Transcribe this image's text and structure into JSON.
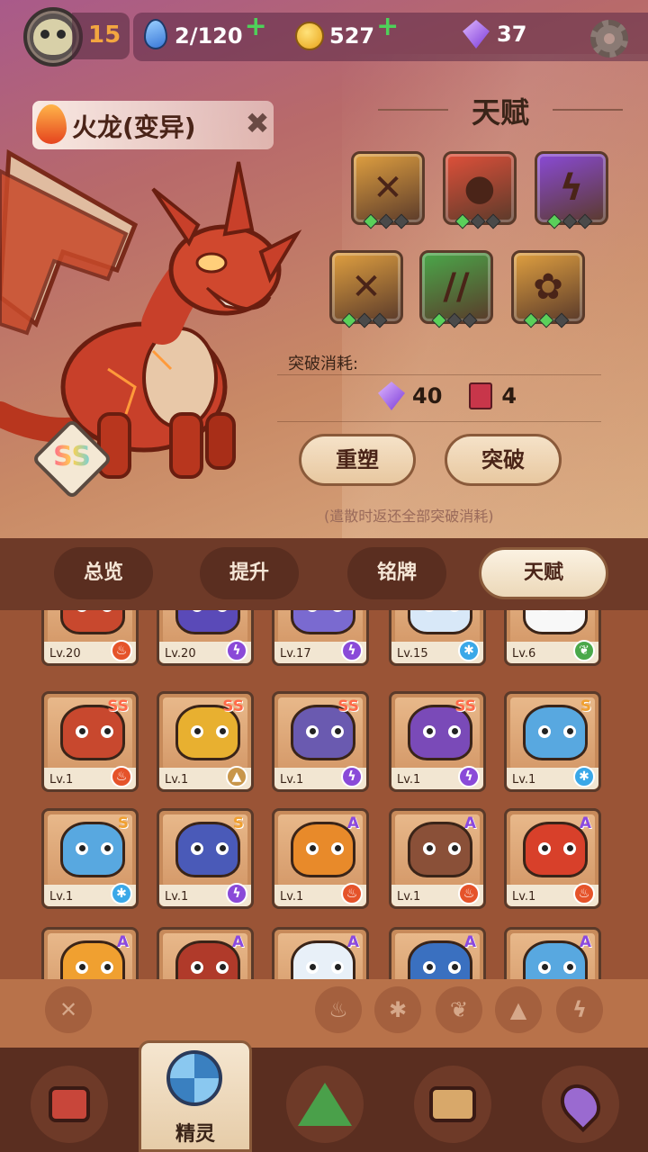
{
  "status": {
    "player_level": "15",
    "stamina": "2/120",
    "coins": "527",
    "gems": "37",
    "icons": [
      "avatar",
      "water-drop-icon",
      "coin-icon",
      "gem-icon",
      "gear-icon"
    ]
  },
  "pet": {
    "name": "火龙(变异)",
    "rank": "SS",
    "element": "fire"
  },
  "talent_panel": {
    "title": "天赋",
    "talents": [
      {
        "icon": "claw-slash-icon",
        "color": "#e0a040",
        "level": 1,
        "max": 3
      },
      {
        "icon": "fire-burst-icon",
        "color": "#e0503a",
        "level": 1,
        "max": 3
      },
      {
        "icon": "lightning-icon",
        "color": "#8a4ad8",
        "level": 1,
        "max": 3
      },
      {
        "icon": "claw-slash-icon",
        "color": "#e0a040",
        "level": 1,
        "max": 3
      },
      {
        "icon": "grass-slash-icon",
        "color": "#4aa84a",
        "level": 1,
        "max": 3
      },
      {
        "icon": "paw-icon",
        "color": "#e0a040",
        "level": 2,
        "max": 3
      }
    ],
    "breakthrough_label": "突破消耗:",
    "cost_gems": "40",
    "cost_books": "4",
    "reset_label": "重塑",
    "breakthrough_button": "突破",
    "note": "(遣散时返还全部突破消耗)"
  },
  "tabs": [
    "总览",
    "提升",
    "铭牌",
    "天赋"
  ],
  "active_tab": "天赋",
  "pets_grid": {
    "row0": [
      {
        "lv": "Lv.20",
        "el": "fire",
        "color": "#c8482e",
        "locked": true
      },
      {
        "lv": "Lv.20",
        "el": "elec",
        "color": "#5a4ab8"
      },
      {
        "lv": "Lv.17",
        "el": "elec",
        "color": "#7a6ad0"
      },
      {
        "lv": "Lv.15",
        "el": "ice",
        "color": "#d8e8f8"
      },
      {
        "lv": "Lv.6",
        "el": "grass",
        "color": "#f8f8f8"
      }
    ],
    "row1": [
      {
        "lv": "Lv.1",
        "rank": "SS",
        "el": "fire",
        "color": "#c8482e"
      },
      {
        "lv": "Lv.1",
        "rank": "SS",
        "el": "earth",
        "color": "#e8b030"
      },
      {
        "lv": "Lv.1",
        "rank": "SS",
        "el": "elec",
        "color": "#6a5ab0"
      },
      {
        "lv": "Lv.1",
        "rank": "SS",
        "el": "elec",
        "color": "#7a4ab8"
      },
      {
        "lv": "Lv.1",
        "rank": "S",
        "el": "ice",
        "color": "#58a8e0"
      }
    ],
    "row2": [
      {
        "lv": "Lv.1",
        "rank": "S",
        "el": "ice",
        "color": "#58a8e0"
      },
      {
        "lv": "Lv.1",
        "rank": "S",
        "el": "elec",
        "color": "#4a5ab8"
      },
      {
        "lv": "Lv.1",
        "rank": "A",
        "el": "fire",
        "color": "#e88a2a"
      },
      {
        "lv": "Lv.1",
        "rank": "A",
        "el": "fire",
        "color": "#8a5038"
      },
      {
        "lv": "Lv.1",
        "rank": "A",
        "el": "fire",
        "color": "#d8402a"
      }
    ],
    "row3": [
      {
        "rank": "A",
        "color": "#f0a030"
      },
      {
        "rank": "A",
        "color": "#b03a2a"
      },
      {
        "rank": "A",
        "color": "#e8f0f8"
      },
      {
        "rank": "A",
        "color": "#3a70c0"
      },
      {
        "rank": "A",
        "color": "#58a8e0"
      }
    ]
  },
  "filters": [
    "clear-filter-icon",
    "fire-filter-icon",
    "ice-filter-icon",
    "grass-filter-icon",
    "earth-filter-icon",
    "electric-filter-icon"
  ],
  "bottom_nav": {
    "active_label": "精灵",
    "items": [
      "backpack-icon",
      "spirit-icon",
      "mountain-icon",
      "chest-icon",
      "map-pin-icon"
    ]
  }
}
